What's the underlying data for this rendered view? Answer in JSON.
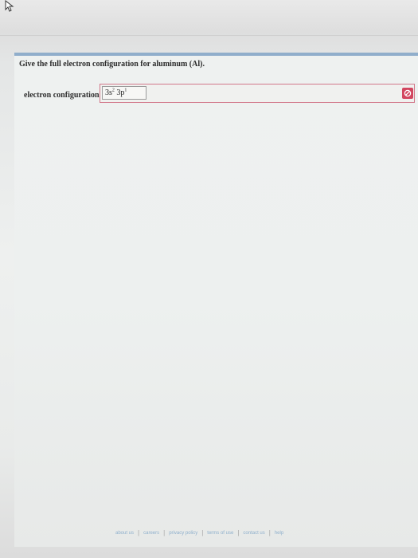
{
  "question": {
    "text": "Give the full electron configuration for aluminum (Al)."
  },
  "answer": {
    "label": "electron configuration:",
    "value_parts": {
      "a_base": "3s",
      "a_sup": "2",
      "b_base": "3p",
      "b_sup": "1"
    },
    "status_icon": "error-icon"
  },
  "footer": {
    "links": [
      "about us",
      "careers",
      "privacy policy",
      "terms of use",
      "contact us",
      "help"
    ]
  },
  "colors": {
    "accent": "#90aecb",
    "error": "#d2465f",
    "link": "#8fb0cc"
  }
}
